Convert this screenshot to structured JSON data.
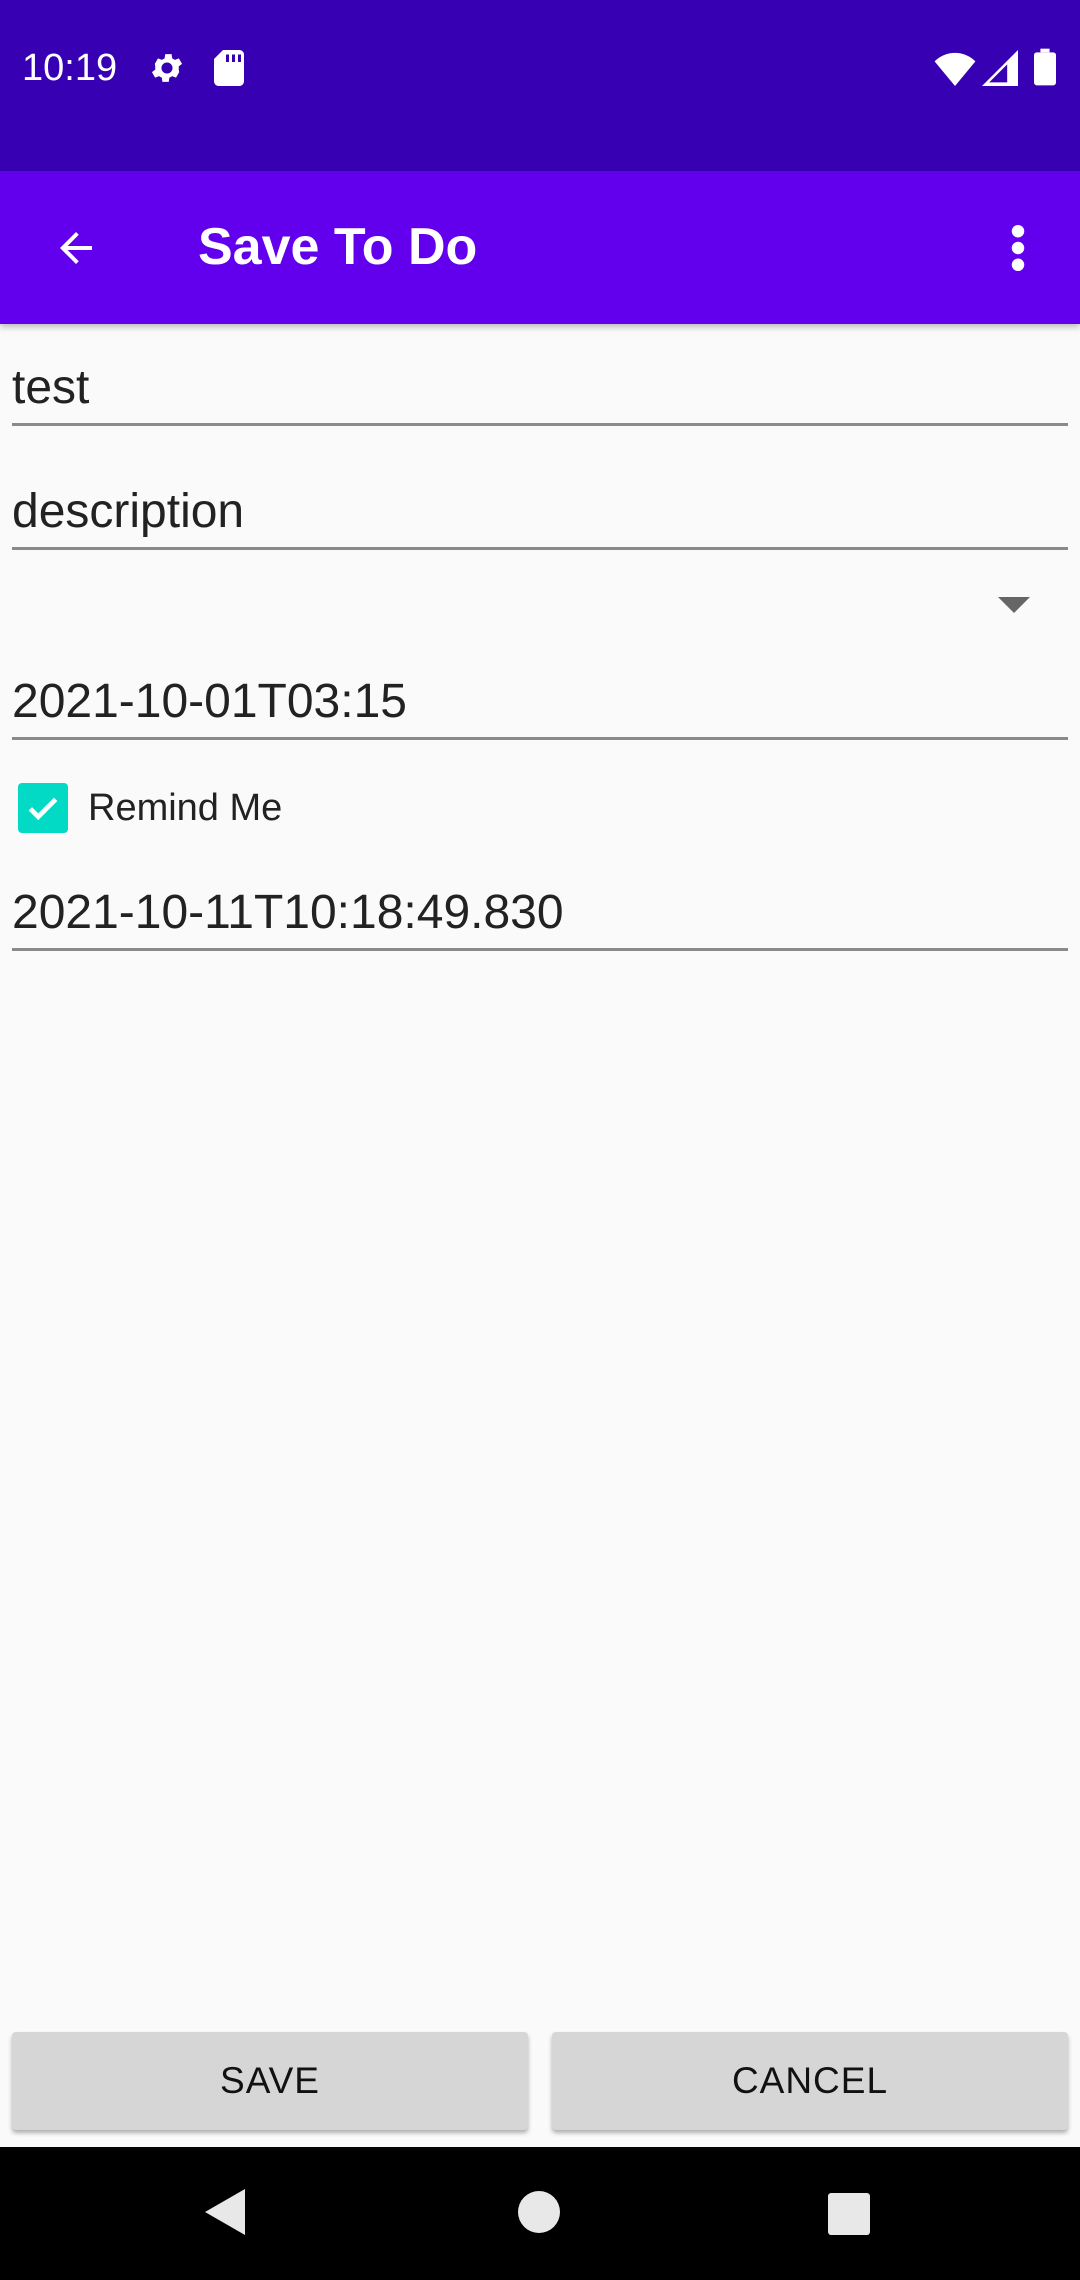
{
  "status_bar": {
    "time": "10:19",
    "icons": [
      "gear-icon",
      "sd-card-icon",
      "wifi-icon",
      "signal-icon",
      "battery-icon"
    ]
  },
  "app_bar": {
    "title": "Save To Do",
    "back_icon": "arrow-back-icon",
    "menu_icon": "more-vert-icon"
  },
  "form": {
    "title_value": "test",
    "description_value": "description",
    "spinner_value": "",
    "due_date_value": "2021-10-01T03:15",
    "remind_me": {
      "label": "Remind Me",
      "checked": true
    },
    "reminder_date_value": "2021-10-11T10:18:49.830"
  },
  "buttons": {
    "save_label": "SAVE",
    "cancel_label": "CANCEL"
  },
  "colors": {
    "status_bar": "#3700b3",
    "app_bar": "#6200ee",
    "accent": "#03dac5"
  },
  "nav_bar": {
    "icons": [
      "back-triangle-icon",
      "home-circle-icon",
      "recents-square-icon"
    ]
  }
}
